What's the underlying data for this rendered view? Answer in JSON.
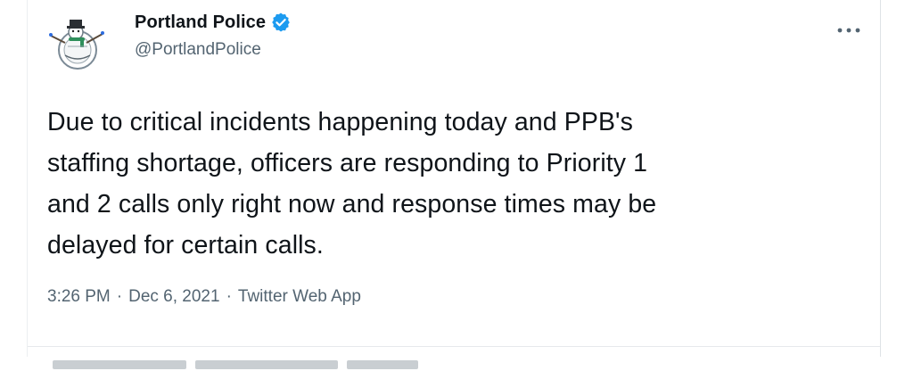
{
  "account": {
    "display_name": "Portland Police",
    "handle": "@PortlandPolice",
    "verified": true,
    "avatar_icon": "snowman-police-badge-avatar"
  },
  "more_icon": "more-options-icon",
  "tweet": {
    "text": "Due to critical incidents happening today and PPB's\nstaffing shortage, officers are responding to Priority 1\nand 2 calls only right now and response times may be\ndelayed for certain calls.",
    "time": "3:26 PM",
    "separator": "·",
    "date": "Dec 6, 2021",
    "source": "Twitter Web App"
  },
  "colors": {
    "verified_blue": "#1d9bf0",
    "text_primary": "#0f1419",
    "text_secondary": "#536471"
  }
}
